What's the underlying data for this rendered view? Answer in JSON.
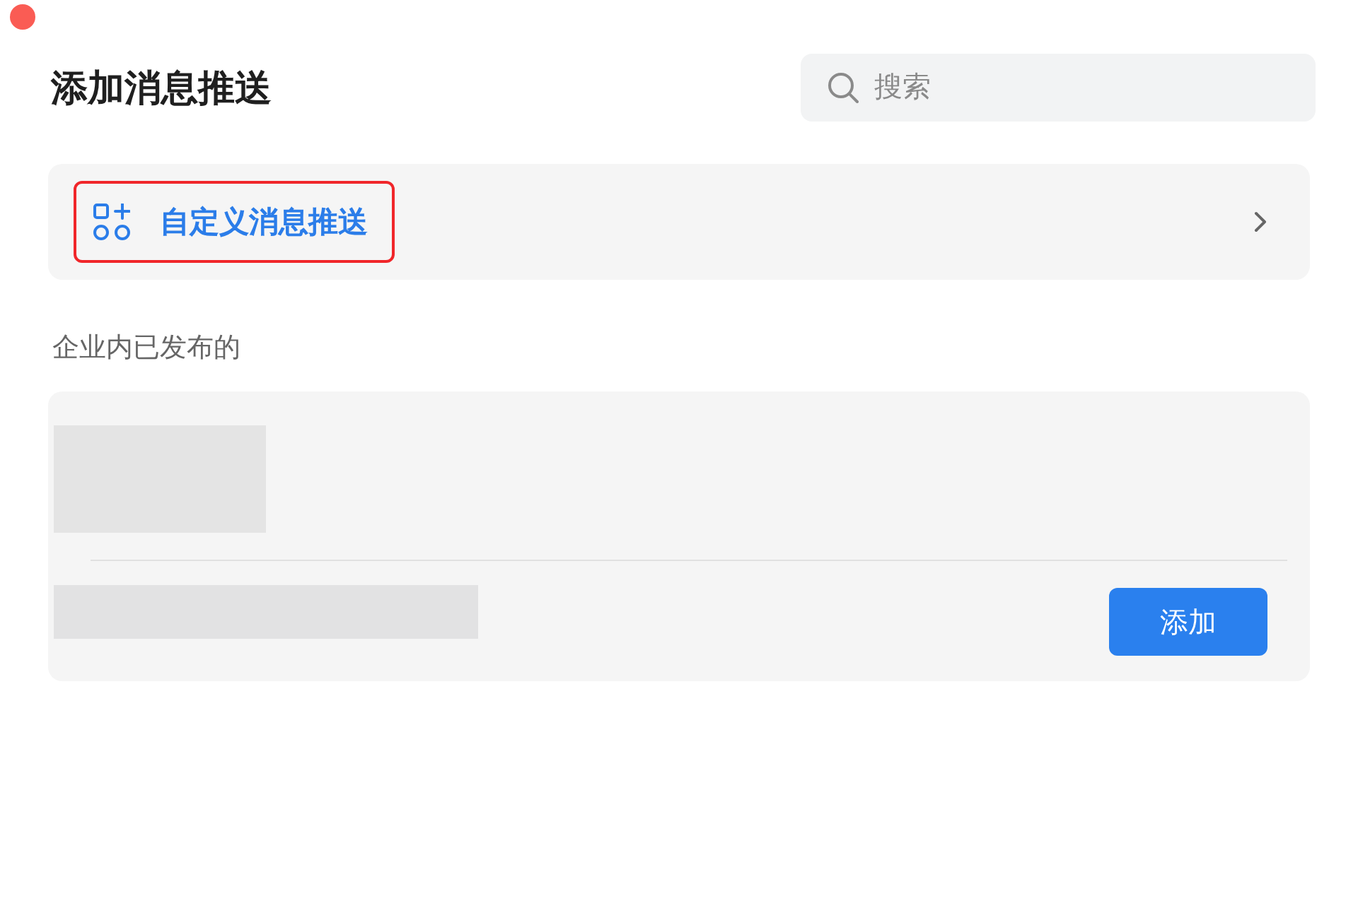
{
  "title": "添加消息推送",
  "search": {
    "placeholder": "搜索"
  },
  "custom_push": {
    "label": "自定义消息推送",
    "highlighted": true
  },
  "section_label": "企业内已发布的",
  "published_card": {
    "button": "添加"
  }
}
